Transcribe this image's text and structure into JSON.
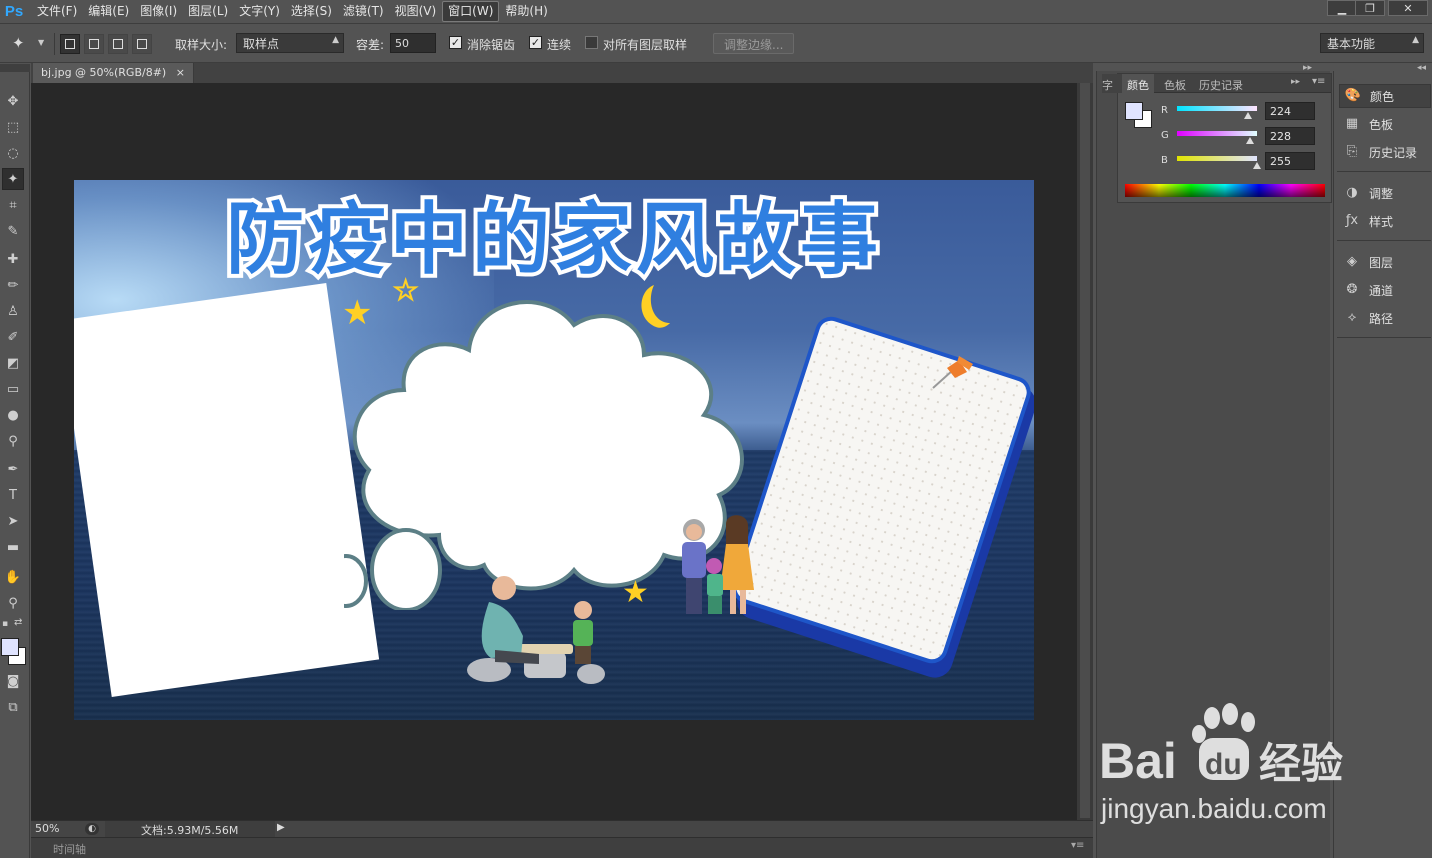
{
  "app": {
    "logo": "Ps"
  },
  "menu": [
    "文件(F)",
    "编辑(E)",
    "图像(I)",
    "图层(L)",
    "文字(Y)",
    "选择(S)",
    "滤镜(T)",
    "视图(V)",
    "窗口(W)",
    "帮助(H)"
  ],
  "options": {
    "sample_size_label": "取样大小:",
    "sample_size_value": "取样点",
    "tolerance_label": "容差:",
    "tolerance_value": "50",
    "antialias_label": "消除锯齿",
    "contiguous_label": "连续",
    "all_layers_label": "对所有图层取样",
    "refine_edge_label": "调整边缘...",
    "workspace_value": "基本功能"
  },
  "document": {
    "tab_title": "bj.jpg @ 50%(RGB/8#)",
    "tab_close": "×",
    "zoom": "50%",
    "doc_info": "文档:5.93M/5.56M"
  },
  "timeline_label": "时间轴",
  "artwork": {
    "title": "防疫中的家风故事"
  },
  "color_panel": {
    "tabs": [
      "字",
      "颜色",
      "色板",
      "历史记录"
    ],
    "r_label": "R",
    "g_label": "G",
    "b_label": "B",
    "r_value": "224",
    "g_value": "228",
    "b_value": "255",
    "foreground": "#e0e4ff"
  },
  "dock": {
    "color": "颜色",
    "swatches": "色板",
    "history": "历史记录",
    "adjustments": "调整",
    "styles": "样式",
    "layers": "图层",
    "channels": "通道",
    "paths": "路径"
  },
  "watermark": {
    "brand": "Bai",
    "brand_tail": "du",
    "brand_cn": "经验",
    "url": "jingyan.baidu.com"
  }
}
